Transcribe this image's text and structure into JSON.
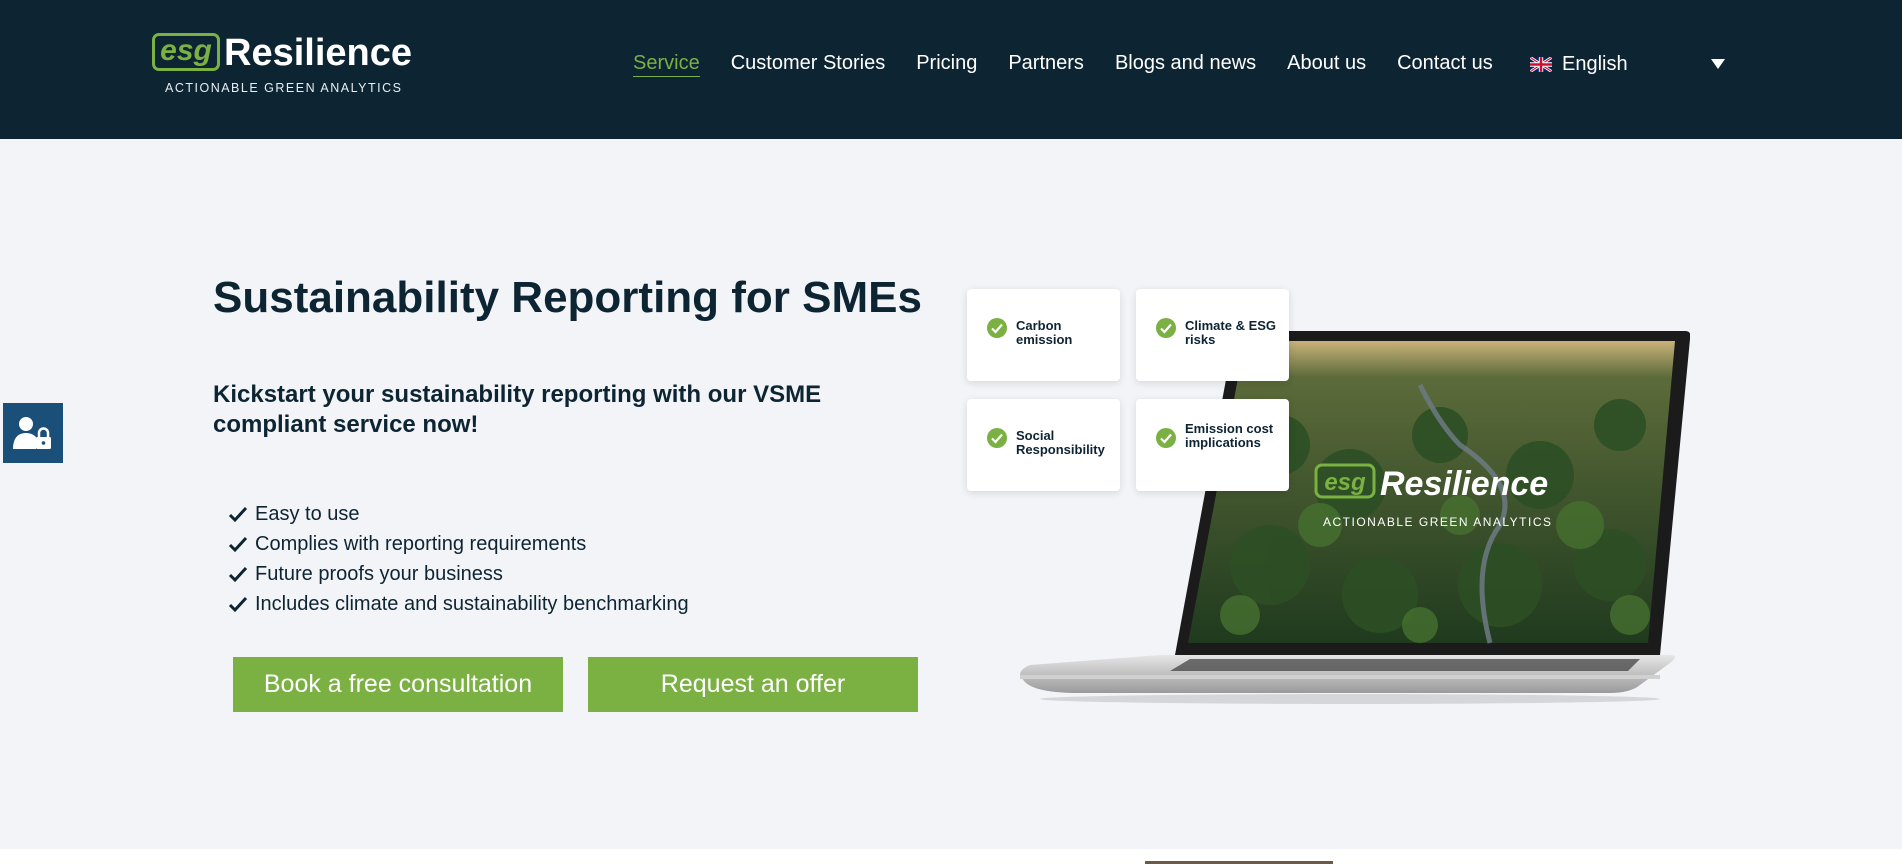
{
  "header": {
    "logo_badge": "esg",
    "logo_word": "Resilience",
    "logo_tagline": "ACTIONABLE GREEN ANALYTICS",
    "nav": [
      {
        "label": "Service",
        "active": true
      },
      {
        "label": "Customer Stories"
      },
      {
        "label": "Pricing"
      },
      {
        "label": "Partners"
      },
      {
        "label": "Blogs and news"
      },
      {
        "label": "About us"
      },
      {
        "label": "Contact us"
      }
    ],
    "language": "English",
    "flag_icon": "uk-flag-icon",
    "caret_icon": "caret-down-icon"
  },
  "accessibility": {
    "icon": "user-lock-icon"
  },
  "hero": {
    "title": "Sustainability Reporting for SMEs",
    "subtitle": "Kickstart your sustainability reporting with our VSME compliant service now!",
    "features": [
      "Easy to use",
      "Complies with reporting requirements",
      "Future proofs your business",
      "Includes climate and sustainability benchmarking"
    ],
    "cta_consult": "Book a free consultation",
    "cta_offer": "Request an offer"
  },
  "feature_cards": [
    {
      "label": "Carbon emission"
    },
    {
      "label": "Climate & ESG risks"
    },
    {
      "label": "Social Responsibility"
    },
    {
      "label": "Emission cost implications"
    }
  ],
  "laptop_screen": {
    "logo_badge": "esg",
    "logo_word": "Resilience",
    "logo_tagline": "ACTIONABLE GREEN ANALYTICS"
  },
  "colors": {
    "navy": "#0d2433",
    "accent_green": "#7bb043",
    "background": "#f2f4f7",
    "a11y_blue": "#1a4f7a"
  }
}
